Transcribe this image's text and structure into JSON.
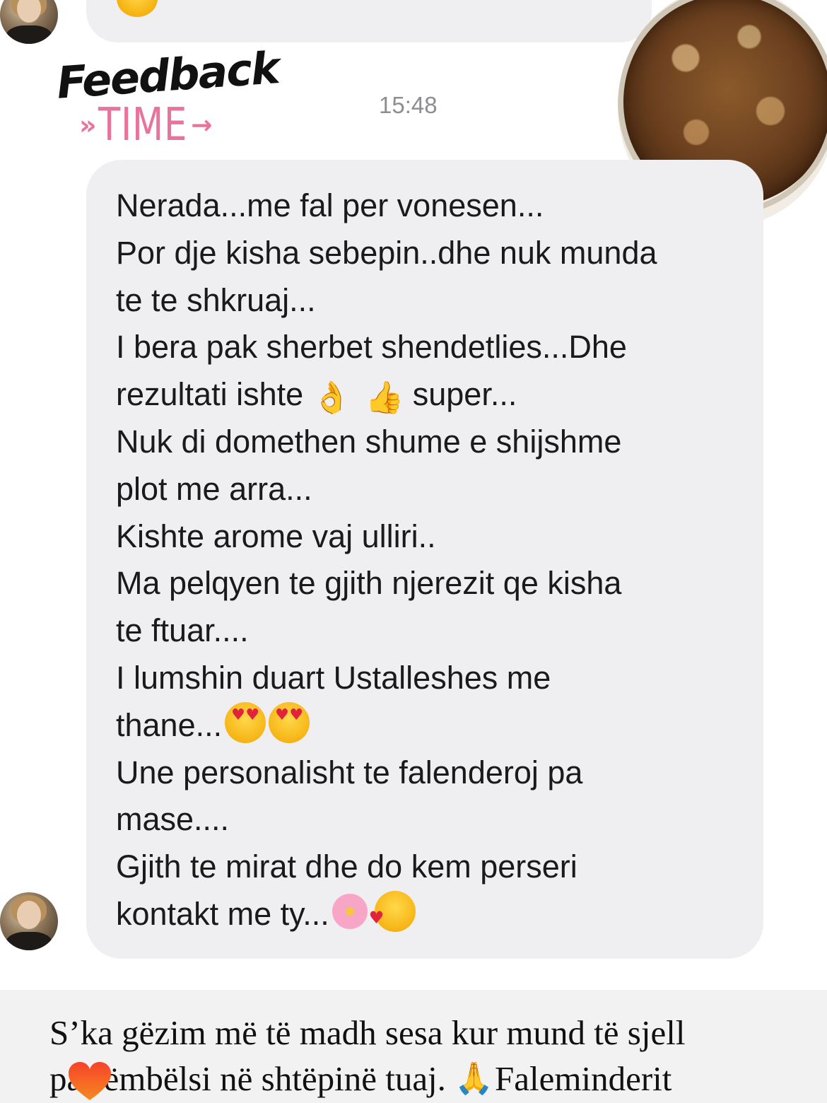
{
  "header": {
    "timestamp": "15:48"
  },
  "logo": {
    "word1": "Feedback",
    "word2": "TIME",
    "arrow_left": "»",
    "arrow_right": "→"
  },
  "message": {
    "lines": [
      "Nerada...me fal per vonesen...",
      "Por dje kisha sebepin..dhe nuk munda",
      "te te shkruaj...",
      "I bera pak sherbet shendetlies...Dhe",
      "rezultati ishte",
      "super...",
      "Nuk di domethen shume e shijshme",
      "plot me arra...",
      "Kishte arome vaj ulliri..",
      "Ma pelqyen te gjith njerezit qe kisha",
      "te ftuar....",
      "I lumshin duart Ustalleshes me",
      "thane...",
      "Une personalisht te falenderoj pa",
      "mase....",
      "Gjith te mirat dhe do kem perseri",
      "kontakt me ty..."
    ],
    "emoji": {
      "ok": "👌",
      "thumbs_up": "👍"
    }
  },
  "caption": {
    "line1": "S’ka gëzim më të madh sesa kur mund të sjell",
    "line2_start": "pa",
    "line2_mid": "ëmbëlsi në shtëpinë tuaj.",
    "pray": "🙏",
    "line2_end": "Faleminderit"
  },
  "colors": {
    "bubble": "#efeff1",
    "timestamp": "#8d8d92",
    "logo_pink": "#e8749c",
    "caption_bar": "#f2f2f2",
    "heart_sticker": "#f0502a"
  }
}
